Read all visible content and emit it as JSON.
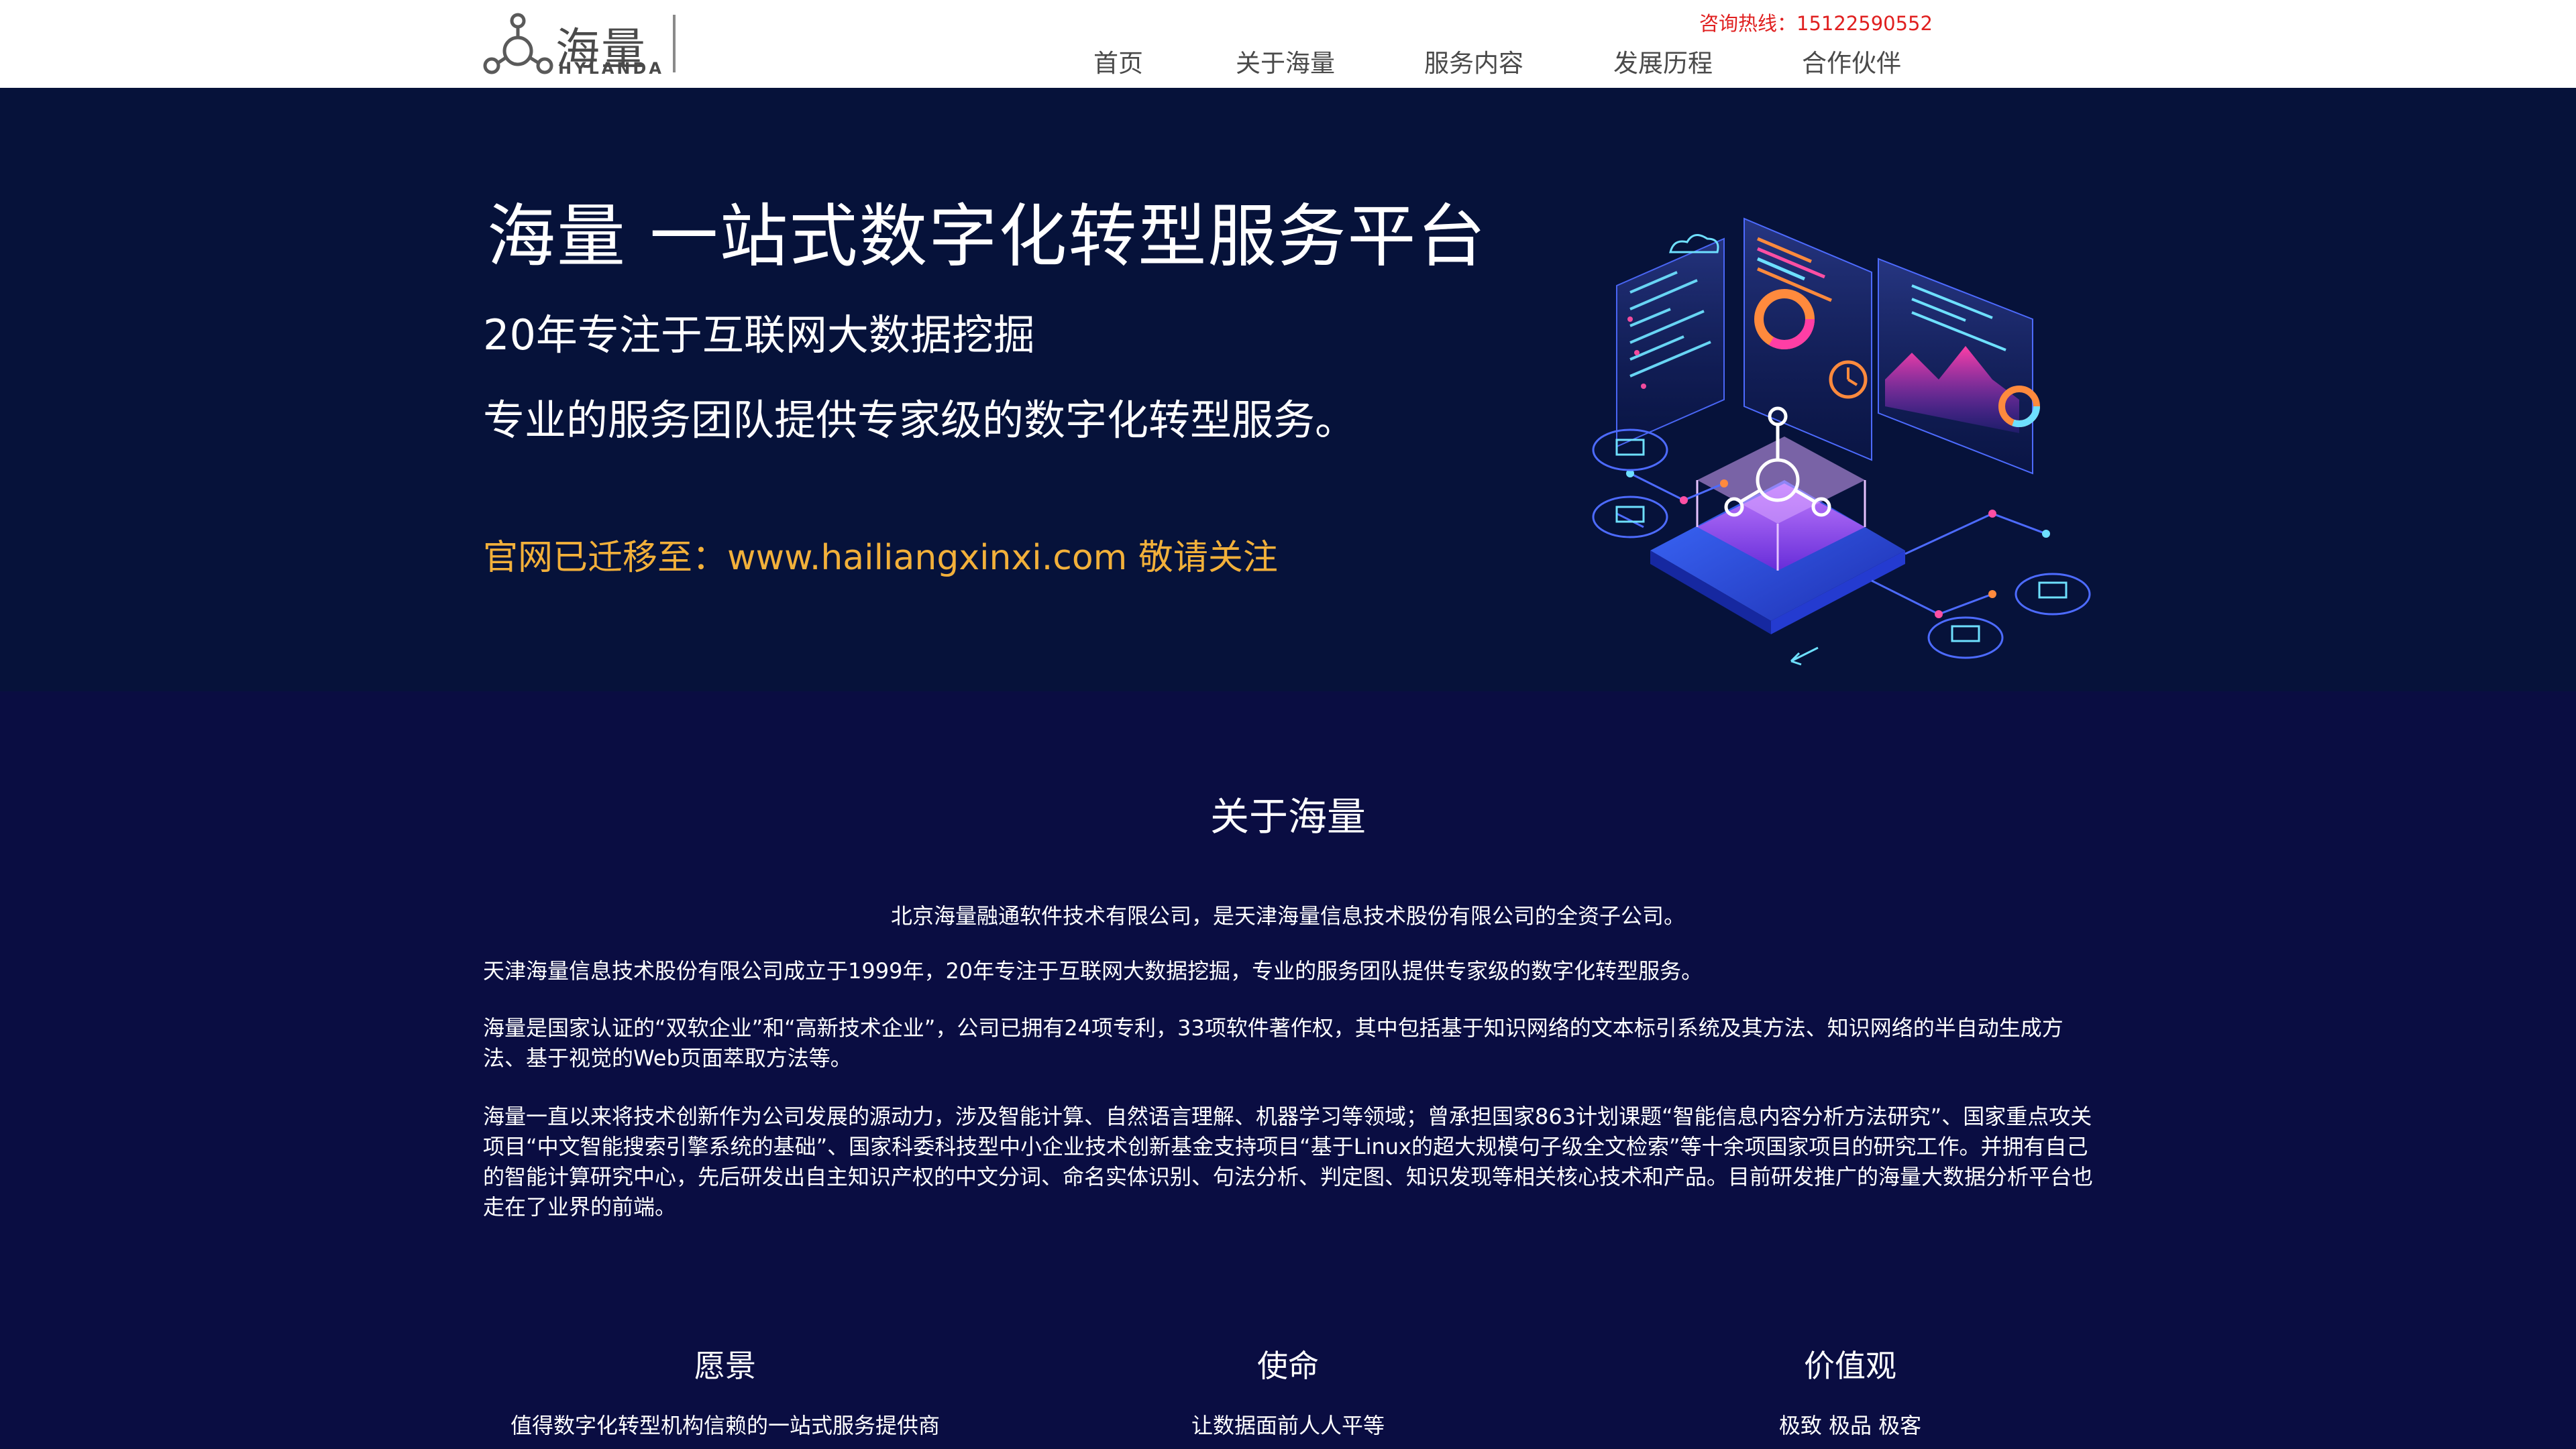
{
  "header": {
    "logo_cn": "海量",
    "logo_en": "HYLANDA",
    "hotline": "咨询热线：15122590552",
    "nav": [
      {
        "label": "首页"
      },
      {
        "label": "关于海量"
      },
      {
        "label": "服务内容"
      },
      {
        "label": "发展历程"
      },
      {
        "label": "合作伙伴"
      }
    ]
  },
  "hero": {
    "title": "海量 一站式数字化转型服务平台",
    "line1": "20年专注于互联网大数据挖掘",
    "line2": "专业的服务团队提供专家级的数字化转型服务。",
    "notice": "官网已迁移至：www.hailiangxinxi.com 敬请关注"
  },
  "about": {
    "title": "关于海量",
    "intro": "北京海量融通软件技术有限公司，是天津海量信息技术股份有限公司的全资子公司。",
    "p2": "天津海量信息技术股份有限公司成立于1999年，20年专注于互联网大数据挖掘，专业的服务团队提供专家级的数字化转型服务。",
    "p3": "海量是国家认证的“双软企业”和“高新技术企业”，公司已拥有24项专利，33项软件著作权，其中包括基于知识网络的文本标引系统及其方法、知识网络的半自动生成方法、基于视觉的Web页面萃取方法等。",
    "p4": "海量一直以来将技术创新作为公司发展的源动力，涉及智能计算、自然语言理解、机器学习等领域；曾承担国家863计划课题“智能信息内容分析方法研究”、国家重点攻关项目“中文智能搜索引擎系统的基础”、国家科委科技型中小企业技术创新基金支持项目“基于Linux的超大规模句子级全文检索”等十余项国家项目的研究工作。并拥有自己的智能计算研究中心，先后研发出自主知识产权的中文分词、命名实体识别、句法分析、判定图、知识发现等相关核心技术和产品。目前研发推广的海量大数据分析平台也走在了业界的前端。",
    "values": [
      {
        "heading": "愿景",
        "text": "值得数字化转型机构信赖的一站式服务提供商"
      },
      {
        "heading": "使命",
        "text": "让数据面前人人平等"
      },
      {
        "heading": "价值观",
        "text": "极致 极品 极客"
      }
    ]
  },
  "colors": {
    "hotline": "#e02020",
    "notice": "#f2b03a",
    "hero_bg": "#06123a",
    "about_bg": "#0a0d42"
  }
}
